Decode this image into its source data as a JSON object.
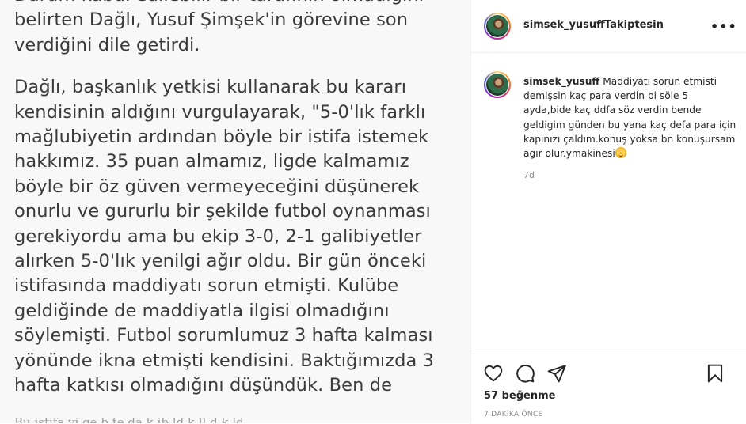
{
  "article": {
    "paragraphs": [
      "Durum kabul edilebilir bir tarafının olmadığını\nbelirten Dağlı, Yusuf Şimşek'in görevine son\nverdiğini dile getirdi.",
      "Dağlı, başkanlık yetkisi kullanarak bu kararı\nkendisinin aldığını vurgulayarak, \"5-0'lık farklı\nmağlubiyetin ardından böyle bir istifa istemek\nhakkımız. 35 puan almamız, ligde kalmamız\nböyle bir öz güven vermeyeceğini düşünerek\nonurlu ve gururlu bir şekilde futbol oynanması\ngerekiyordu ama bu ekip 3-0, 2-1 galibiyetler\nalırken 5-0'lık yenilgi ağır oldu. Bir gün önceki\nistifasında maddiyatı sorun etmişti. Kulübe\ngeldiğinde de maddiyatla ilgisi olmadığını\nsöylemişti. Futbol sorumlumuz 3 hafta kalması\nyönünde ikna etmişti kendisini. Baktığımızda 3\nhafta katkısı olmadığını düşündük. Ben de"
    ],
    "footer": "Bu istifa yi ge b te da k ib ld k ll d k ld"
  },
  "header": {
    "username": "simsek_yusuff",
    "separator": "•",
    "follow_status": "Takiptesin",
    "more_icon": "more-horizontal-icon"
  },
  "comment": {
    "username": "simsek_yusuff",
    "text": "Maddiyatı sorun etmisti demişsin kaç para verdin bi söle 5 ayda,bide kaç ddfa söz verdin bende geldigim günden bu yana kaç defa para için kapınızı çaldım.konuş yoksa bn konuşursam agır olur.ymakinesi",
    "emoji": "grinning-face-emoji",
    "time": "7d"
  },
  "actions": {
    "icons": [
      "heart-icon",
      "comment-icon",
      "share-icon",
      "bookmark-icon"
    ],
    "likes": "57 beğenme",
    "posted": "7 DAKİKA ÖNCE"
  },
  "colors": {
    "text": "#262626",
    "muted": "#8e8e8e",
    "border": "#efefef"
  }
}
